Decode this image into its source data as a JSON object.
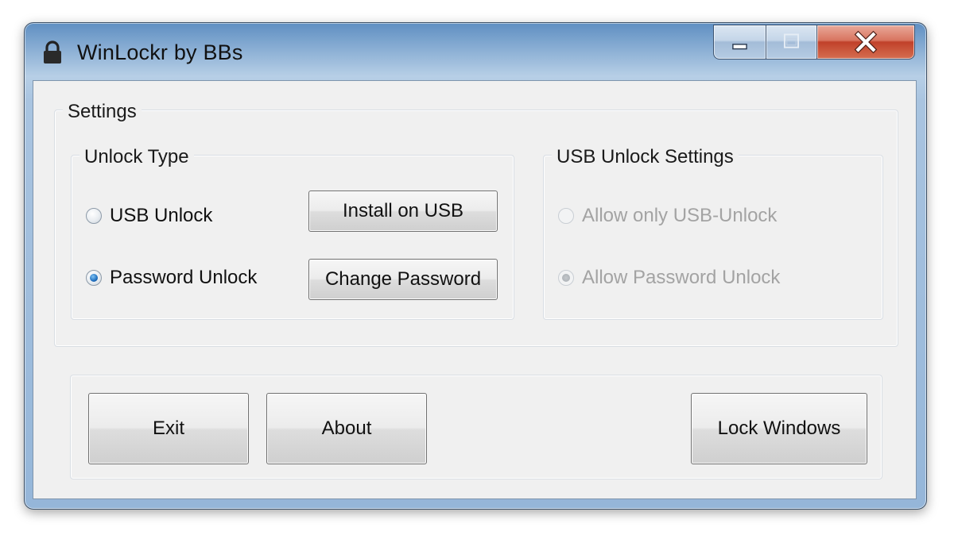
{
  "window": {
    "title": "WinLockr by BBs",
    "icon": "padlock-icon"
  },
  "caption_buttons": {
    "minimize_icon": "minimize-icon",
    "maximize_icon": "maximize-icon",
    "close_icon": "close-icon"
  },
  "settings": {
    "label": "Settings",
    "unlock_type": {
      "label": "Unlock Type",
      "options": [
        {
          "label": "USB Unlock",
          "checked": false
        },
        {
          "label": "Password Unlock",
          "checked": true
        }
      ],
      "install_button": "Install on USB",
      "change_password_button": "Change Password"
    },
    "usb_settings": {
      "label": "USB Unlock Settings",
      "options": [
        {
          "label": "Allow only USB-Unlock",
          "checked": false,
          "enabled": false
        },
        {
          "label": "Allow Password Unlock",
          "checked": true,
          "enabled": false
        }
      ]
    }
  },
  "actions": {
    "exit": "Exit",
    "about": "About",
    "lock": "Lock Windows"
  },
  "colors": {
    "titlebar": "#95b6d9",
    "client_bg": "#f0f0f0",
    "close_button": "#c0412a",
    "radio_checked": "#1f6fbf",
    "disabled_text": "#a3a3a3"
  }
}
